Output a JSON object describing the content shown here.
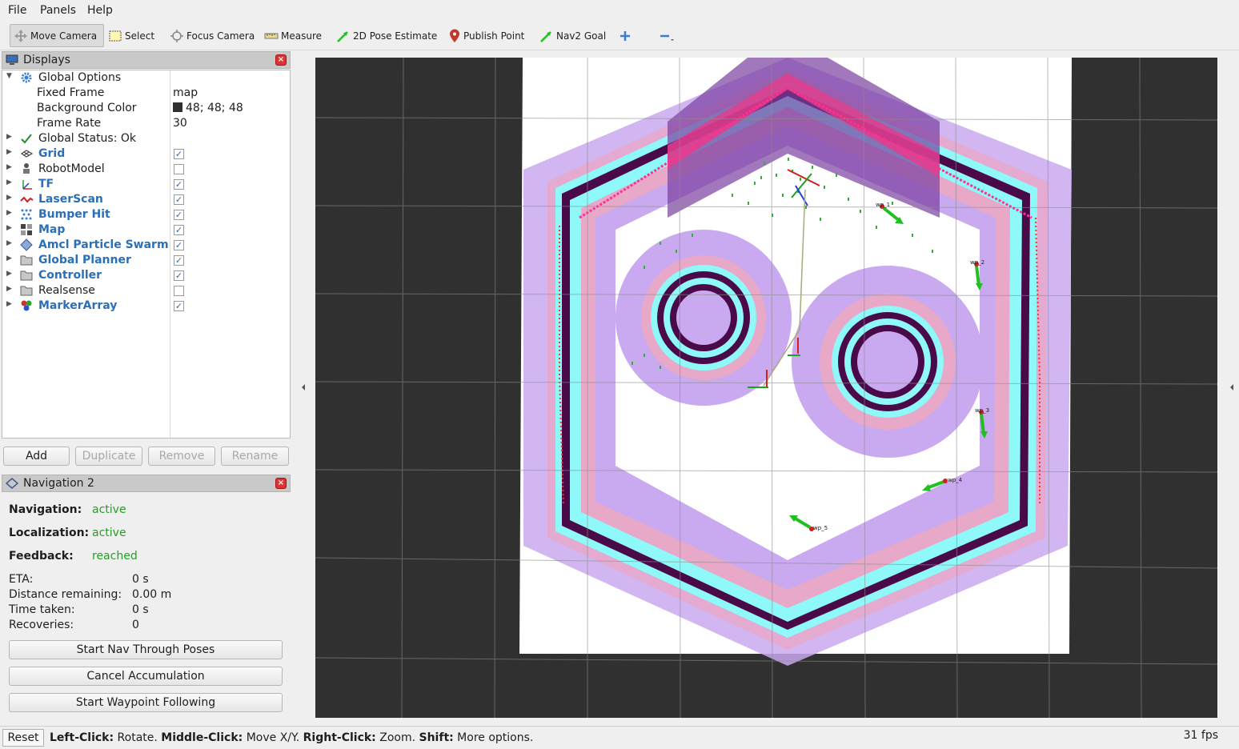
{
  "menu": {
    "file": "File",
    "panels": "Panels",
    "help": "Help"
  },
  "toolbar": {
    "move_camera": "Move Camera",
    "select": "Select",
    "focus_camera": "Focus Camera",
    "measure": "Measure",
    "pose_estimate": "2D Pose Estimate",
    "publish_point": "Publish Point",
    "nav2_goal": "Nav2 Goal"
  },
  "displays": {
    "title": "Displays",
    "global_options": "Global Options",
    "fixed_frame_label": "Fixed Frame",
    "fixed_frame_value": "map",
    "background_color_label": "Background Color",
    "background_color_value": "48; 48; 48",
    "frame_rate_label": "Frame Rate",
    "frame_rate_value": "30",
    "global_status": "Global Status: Ok",
    "items": [
      {
        "label": "Grid",
        "checked": true
      },
      {
        "label": "RobotModel",
        "checked": false
      },
      {
        "label": "TF",
        "checked": true
      },
      {
        "label": "LaserScan",
        "checked": true
      },
      {
        "label": "Bumper Hit",
        "checked": true
      },
      {
        "label": "Map",
        "checked": true
      },
      {
        "label": "Amcl Particle Swarm",
        "checked": true
      },
      {
        "label": "Global Planner",
        "checked": true
      },
      {
        "label": "Controller",
        "checked": true
      },
      {
        "label": "Realsense",
        "checked": false
      },
      {
        "label": "MarkerArray",
        "checked": true
      }
    ],
    "buttons": {
      "add": "Add",
      "duplicate": "Duplicate",
      "remove": "Remove",
      "rename": "Rename"
    }
  },
  "navigation": {
    "title": "Navigation 2",
    "navigation_label": "Navigation:",
    "navigation_value": "active",
    "localization_label": "Localization:",
    "localization_value": "active",
    "feedback_label": "Feedback:",
    "feedback_value": "reached",
    "eta_label": "ETA:",
    "eta_value": "0 s",
    "distance_label": "Distance remaining:",
    "distance_value": "0.00 m",
    "time_label": "Time taken:",
    "time_value": "0 s",
    "recoveries_label": "Recoveries:",
    "recoveries_value": "0",
    "btn_nav_through_poses": "Start Nav Through Poses",
    "btn_cancel": "Cancel Accumulation",
    "btn_waypoint": "Start Waypoint Following"
  },
  "status": {
    "reset": "Reset",
    "hint_left": "Left-Click:",
    "hint_left_v": " Rotate. ",
    "hint_middle": "Middle-Click:",
    "hint_middle_v": " Move X/Y. ",
    "hint_right": "Right-Click:",
    "hint_right_v": " Zoom. ",
    "hint_shift": "Shift:",
    "hint_shift_v": " More options.",
    "fps": "31 fps"
  },
  "waypoints": [
    "wp_1",
    "wp_2",
    "wp_3",
    "wp_4",
    "wp_5"
  ],
  "colors": {
    "background": "#303030",
    "inflation": "#c8a8f0",
    "obstacle": "#4a0a4a",
    "inscribed": "#8ff8f8",
    "accent_blue": "#2b6fb6"
  }
}
